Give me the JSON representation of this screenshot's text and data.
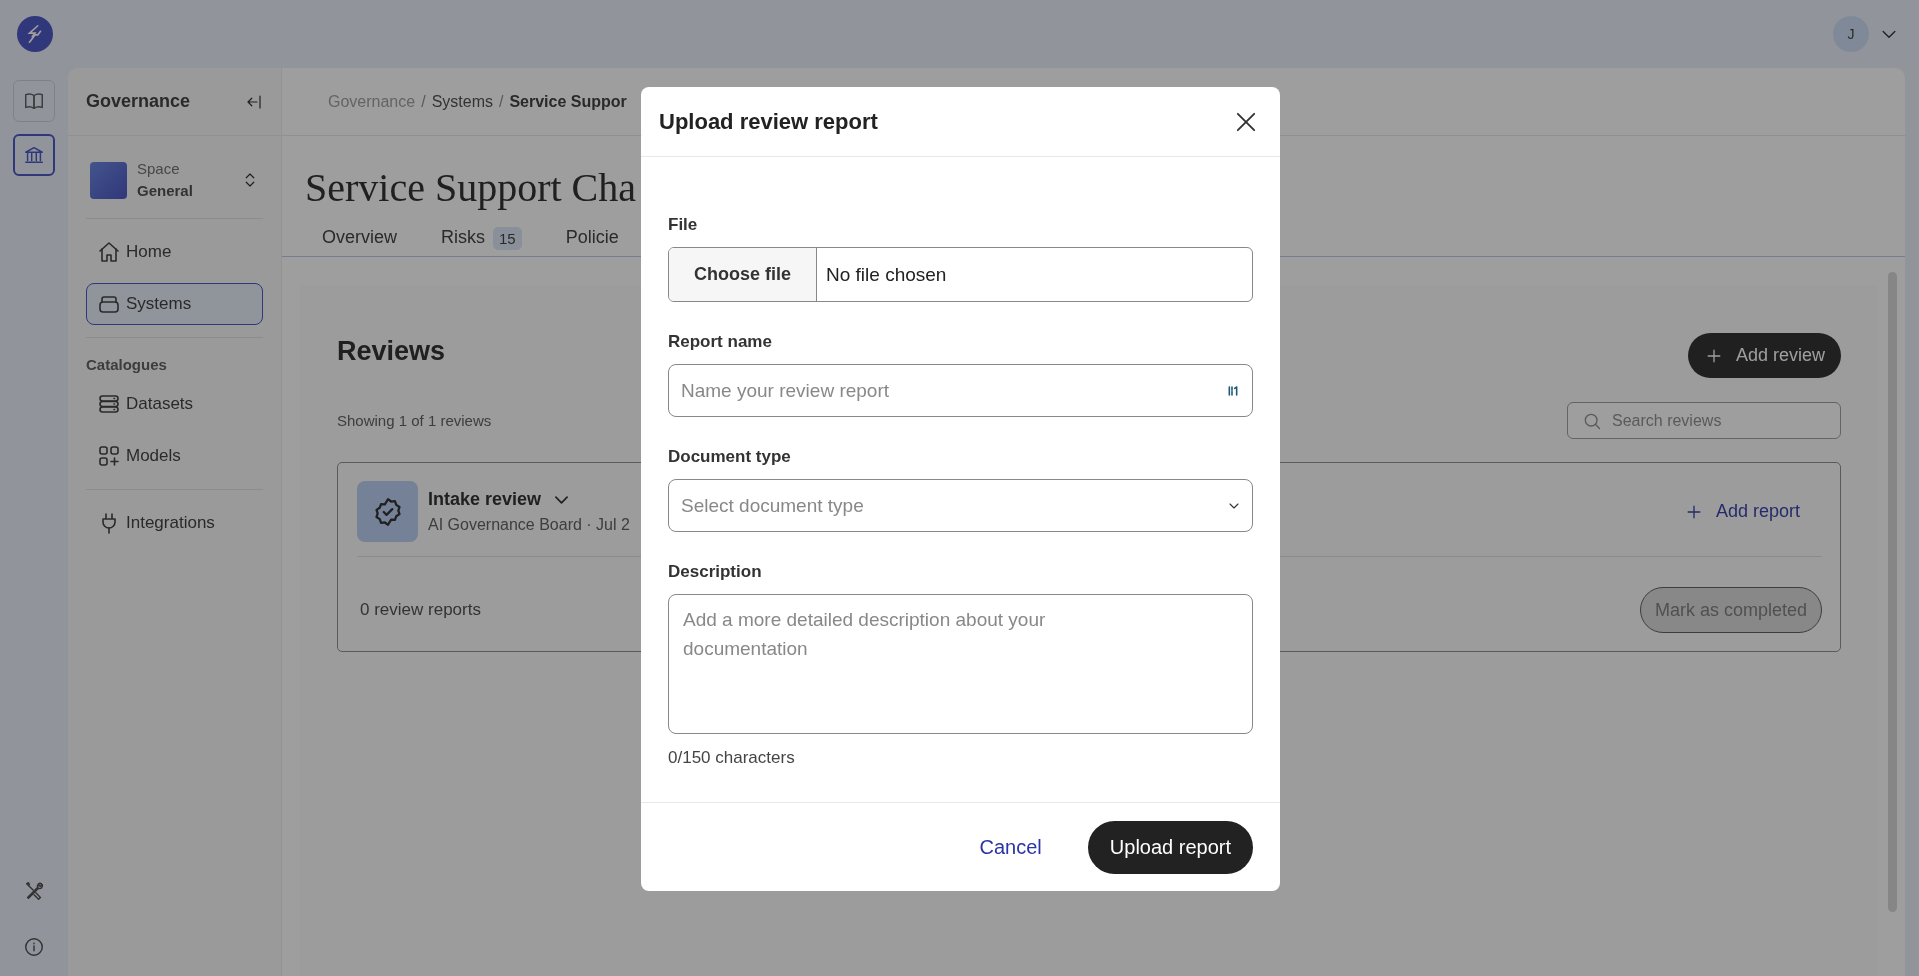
{
  "top_bar": {
    "avatar_initial": "J"
  },
  "rail": [
    {
      "kind": "book",
      "selected": false
    },
    {
      "kind": "bank",
      "selected": true
    }
  ],
  "rail_bottom": [
    {
      "kind": "tools"
    },
    {
      "kind": "info"
    }
  ],
  "sidebar": {
    "title": "Governance",
    "space": {
      "label": "Space",
      "name": "General"
    },
    "groups": [
      {
        "items": [
          {
            "label": "Home",
            "kind": "home",
            "selected": false
          },
          {
            "label": "Systems",
            "kind": "systems",
            "selected": true
          }
        ]
      },
      {
        "heading": "Catalogues",
        "items": [
          {
            "label": "Datasets",
            "kind": "datasets",
            "selected": false
          },
          {
            "label": "Models",
            "kind": "models",
            "selected": false
          }
        ]
      },
      {
        "items": [
          {
            "label": "Integrations",
            "kind": "plug",
            "selected": false
          }
        ]
      }
    ]
  },
  "breadcrumb": [
    "Governance",
    "Systems",
    "Service Suppor"
  ],
  "breadcrumb_separator": "/",
  "page_title": "Service Support Cha",
  "tabs": [
    {
      "label": "Overview",
      "selected": false
    },
    {
      "label": "Risks",
      "badge": "15",
      "selected": false
    },
    {
      "label": "Policie",
      "selected": false
    }
  ],
  "reviews": {
    "title": "Reviews",
    "add_button": "Add review",
    "count_text": "Showing 1 of 1 reviews",
    "search": {
      "placeholder": "Search reviews"
    },
    "items": [
      {
        "title": "Intake review",
        "meta": "AI Governance Board · Jul 2",
        "add_report": "Add report",
        "reports_text": "0 review reports",
        "complete_button": {
          "label": "Mark as completed",
          "disabled": true
        }
      }
    ]
  },
  "modal": {
    "title": "Upload review report",
    "fields": [
      {
        "kind": "file",
        "label": "File",
        "button": "Choose file",
        "value": "No file chosen"
      },
      {
        "kind": "text",
        "label": "Report name",
        "placeholder": "Name your review report"
      },
      {
        "kind": "select",
        "label": "Document type",
        "placeholder": "Select document type"
      },
      {
        "kind": "textarea",
        "label": "Description",
        "placeholder": "Add a more detailed description about your documentation",
        "counter": "0/150 characters"
      }
    ],
    "cancel": "Cancel",
    "submit": "Upload report"
  }
}
